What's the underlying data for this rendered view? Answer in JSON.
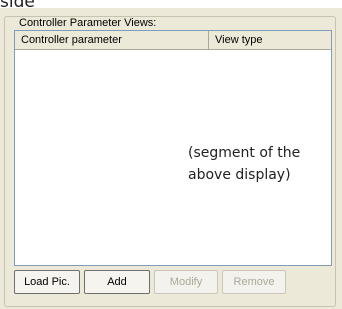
{
  "caption_top": "side",
  "group": {
    "title": "Controller Parameter Views:"
  },
  "list": {
    "columns": [
      "Controller parameter",
      "View type"
    ]
  },
  "note": "(segment of the above display)",
  "buttons": {
    "load_pic": "Load Pic.",
    "add": "Add",
    "modify": "Modify",
    "remove": "Remove"
  }
}
